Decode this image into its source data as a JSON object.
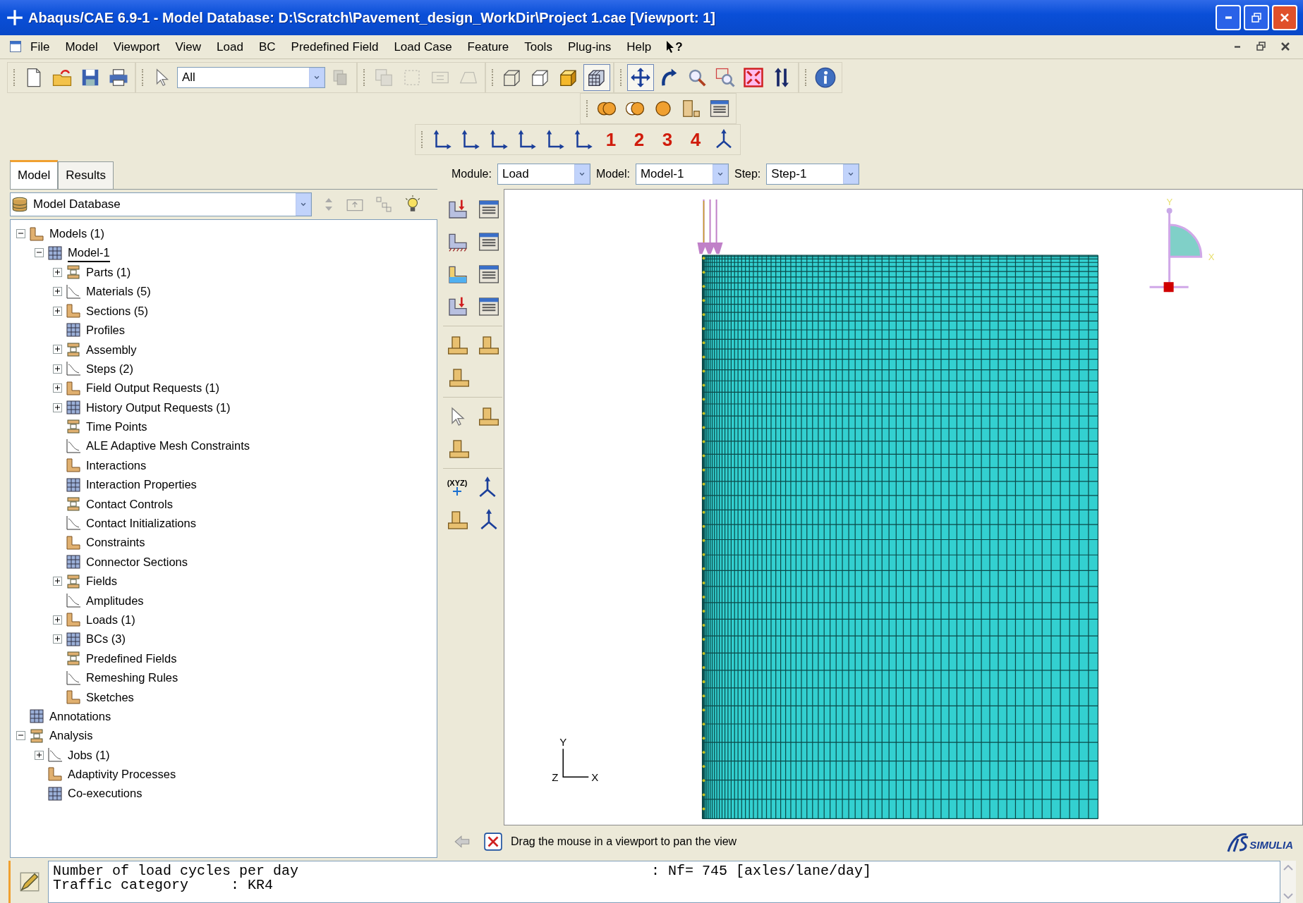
{
  "window": {
    "title": "Abaqus/CAE 6.9-1 - Model Database: D:\\Scratch\\Pavement_design_WorkDir\\Project 1.cae [Viewport: 1]"
  },
  "menu": {
    "items": [
      "File",
      "Model",
      "Viewport",
      "View",
      "Load",
      "BC",
      "Predefined Field",
      "Load Case",
      "Feature",
      "Tools",
      "Plug-ins",
      "Help"
    ],
    "whats_this": "?"
  },
  "toolbar": {
    "selection_filter": "All",
    "tools": [
      {
        "pressed": false,
        "disabled": false
      },
      {
        "pressed": false,
        "disabled": false
      },
      {
        "pressed": false,
        "disabled": false
      },
      {
        "pressed": false,
        "disabled": false
      },
      {
        "pressed": false,
        "disabled": false
      },
      {
        "pressed": false,
        "disabled": true
      },
      {
        "pressed": false,
        "disabled": true
      },
      {
        "pressed": false,
        "disabled": true
      },
      {
        "pressed": false,
        "disabled": true
      },
      {
        "pressed": false,
        "disabled": true
      },
      {
        "pressed": false,
        "disabled": false
      },
      {
        "pressed": false,
        "disabled": false
      },
      {
        "pressed": false,
        "disabled": false
      },
      {
        "pressed": true,
        "disabled": false
      },
      {
        "pressed": true,
        "disabled": false
      },
      {
        "pressed": false,
        "disabled": false
      },
      {
        "pressed": false,
        "disabled": false
      },
      {
        "pressed": false,
        "disabled": false
      },
      {
        "pressed": false,
        "disabled": false
      },
      {
        "pressed": false,
        "disabled": false
      },
      {
        "pressed": false,
        "disabled": false
      }
    ]
  },
  "view_toolbar": {
    "viewports": [
      "1",
      "2",
      "3",
      "4"
    ]
  },
  "tabs": [
    {
      "label": "Model",
      "selected": true
    },
    {
      "label": "Results",
      "selected": false
    }
  ],
  "context_bar": [
    {
      "label": "Module:",
      "value": "Load"
    },
    {
      "label": "Model:",
      "value": "Model-1"
    },
    {
      "label": "Step:",
      "value": "Step-1"
    }
  ],
  "tree_source": {
    "value": "Model Database"
  },
  "tree": [
    {
      "label": "Models (1)",
      "expanded": true,
      "selected": false,
      "children": [
        {
          "label": "Model-1",
          "expanded": true,
          "selected": true,
          "children": [
            {
              "label": "Parts (1)",
              "expanded": false,
              "selected": false
            },
            {
              "label": "Materials (5)",
              "expanded": false,
              "selected": false
            },
            {
              "label": "Sections (5)",
              "expanded": false,
              "selected": false
            },
            {
              "label": "Profiles",
              "selected": false
            },
            {
              "label": "Assembly",
              "expanded": false,
              "selected": false
            },
            {
              "label": "Steps (2)",
              "expanded": false,
              "selected": false
            },
            {
              "label": "Field Output Requests (1)",
              "expanded": false,
              "selected": false
            },
            {
              "label": "History Output Requests (1)",
              "expanded": false,
              "selected": false
            },
            {
              "label": "Time Points",
              "selected": false
            },
            {
              "label": "ALE Adaptive Mesh Constraints",
              "selected": false
            },
            {
              "label": "Interactions",
              "selected": false
            },
            {
              "label": "Interaction Properties",
              "selected": false
            },
            {
              "label": "Contact Controls",
              "selected": false
            },
            {
              "label": "Contact Initializations",
              "selected": false
            },
            {
              "label": "Constraints",
              "selected": false
            },
            {
              "label": "Connector Sections",
              "selected": false
            },
            {
              "label": "Fields",
              "expanded": false,
              "selected": false
            },
            {
              "label": "Amplitudes",
              "selected": false
            },
            {
              "label": "Loads (1)",
              "expanded": false,
              "selected": false
            },
            {
              "label": "BCs (3)",
              "expanded": false,
              "selected": false
            },
            {
              "label": "Predefined Fields",
              "selected": false
            },
            {
              "label": "Remeshing Rules",
              "selected": false
            },
            {
              "label": "Sketches",
              "selected": false
            }
          ]
        }
      ]
    },
    {
      "label": "Annotations",
      "selected": false
    },
    {
      "label": "Analysis",
      "expanded": true,
      "selected": false,
      "children": [
        {
          "label": "Jobs (1)",
          "expanded": false,
          "selected": false
        },
        {
          "label": "Adaptivity Processes",
          "selected": false
        },
        {
          "label": "Co-executions",
          "selected": false
        }
      ]
    }
  ],
  "toolbox": {
    "datum_label": "(XYZ)"
  },
  "viewport": {
    "orientation_labels": {
      "y": "Y",
      "x": "X"
    },
    "triad_labels": {
      "y": "Y",
      "z": "Z",
      "x": "X"
    }
  },
  "prompt": {
    "text": "Drag the mouse in a viewport to pan the view"
  },
  "logo": {
    "text": "SIMULIA"
  },
  "message_area": {
    "lines": [
      {
        "text": "Number of load cycles per day",
        "value": ": Nf= 745 [axles/lane/day]"
      },
      {
        "text": "Traffic category     : KR4"
      }
    ]
  }
}
